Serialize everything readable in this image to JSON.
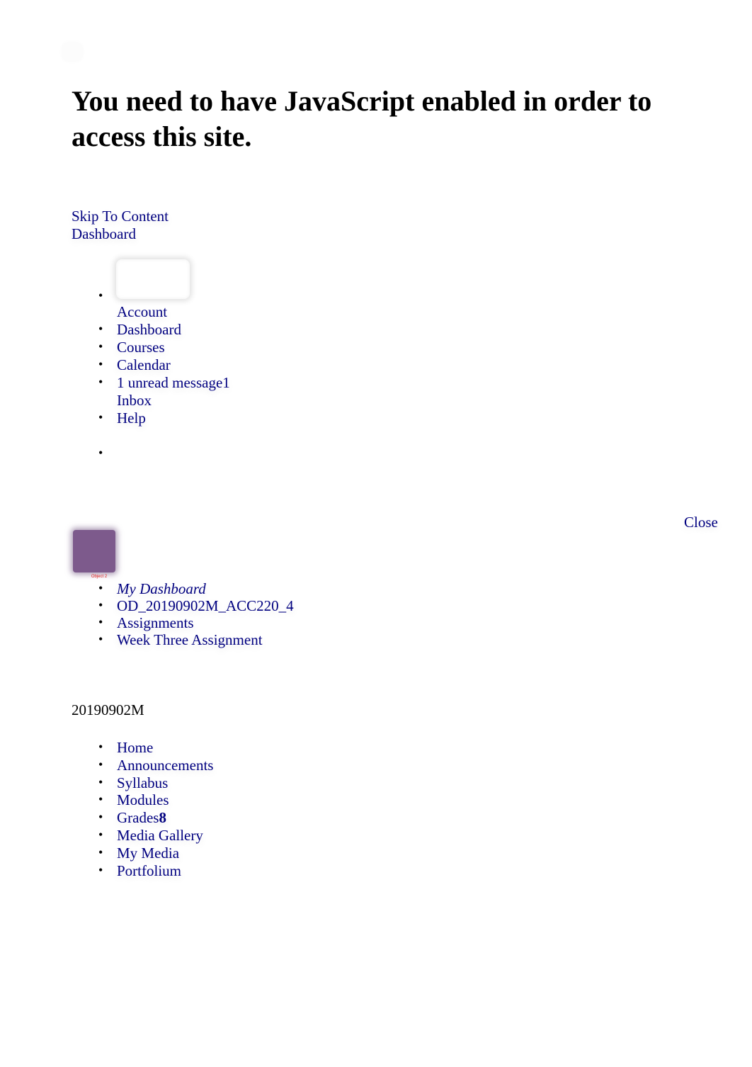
{
  "noscript": {
    "heading": "You need to have JavaScript enabled in order to access this site."
  },
  "top_links": {
    "skip_to_content": "Skip To Content",
    "dashboard": "Dashboard"
  },
  "global_nav": {
    "items": [
      {
        "label": "Account",
        "icon": "avatar-placeholder"
      },
      {
        "label": "Dashboard"
      },
      {
        "label": "Courses"
      },
      {
        "label": "Calendar"
      },
      {
        "label": "1 unread message1",
        "sublabel": "Inbox"
      },
      {
        "label": "Help"
      },
      {
        "label": ""
      }
    ]
  },
  "tray": {
    "close_label": "Close"
  },
  "course_image": {
    "label": "Object 2",
    "color": "#7d5a8c"
  },
  "breadcrumbs": [
    {
      "label": "My Dashboard"
    },
    {
      "label": "OD_20190902M_ACC220_4"
    },
    {
      "label": "Assignments"
    },
    {
      "label": "Week Three Assignment"
    }
  ],
  "term": "20190902M",
  "course_nav": {
    "items": [
      {
        "label": "Home"
      },
      {
        "label": "Announcements"
      },
      {
        "label": "Syllabus"
      },
      {
        "label": "Modules"
      },
      {
        "label": "Grades",
        "badge": "8"
      },
      {
        "label": "Media Gallery"
      },
      {
        "label": "My Media"
      },
      {
        "label": "Portfolium"
      }
    ]
  },
  "colors": {
    "link": "#000080",
    "text": "#000000",
    "background": "#ffffff"
  }
}
